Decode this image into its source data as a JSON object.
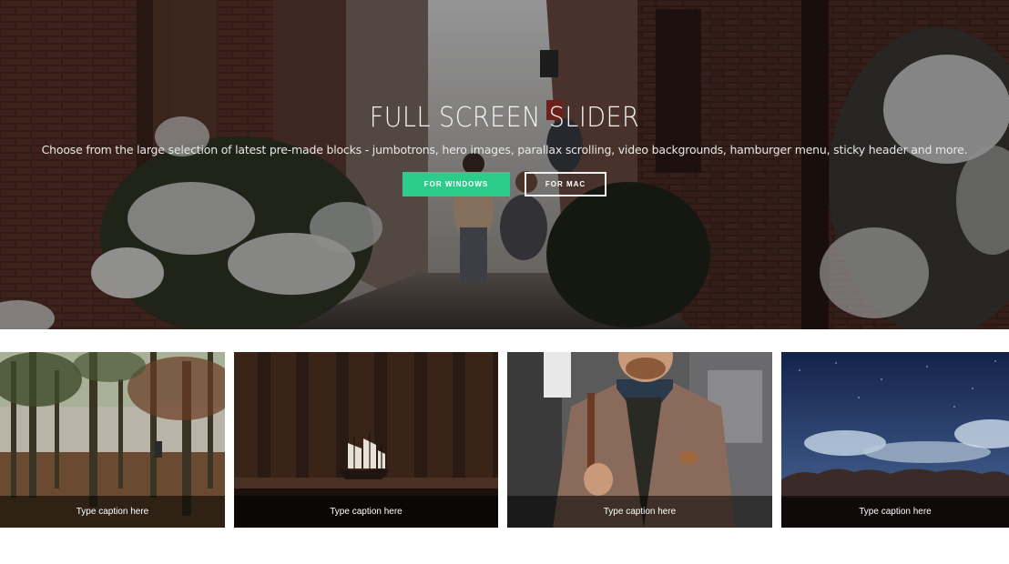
{
  "hero": {
    "title": "FULL SCREEN SLIDER",
    "subtitle": "Choose from the large selection of latest pre-made blocks - jumbotrons, hero images, parallax scrolling, video backgrounds, hamburger menu, sticky header and more.",
    "button_primary": "FOR WINDOWS",
    "button_secondary": "FOR MAC"
  },
  "gallery": {
    "items": [
      {
        "caption": "Type caption here",
        "image": "forest-photo"
      },
      {
        "caption": "Type caption here",
        "image": "ship-model-on-wood-photo"
      },
      {
        "caption": "Type caption here",
        "image": "man-in-tweed-jacket-photo"
      },
      {
        "caption": "Type caption here",
        "image": "night-sky-treeline-photo"
      }
    ]
  },
  "colors": {
    "primary_button": "#2ecc8a",
    "caption_bar": "rgba(0,0,0,0.55)",
    "page_background": "#ffffff"
  }
}
